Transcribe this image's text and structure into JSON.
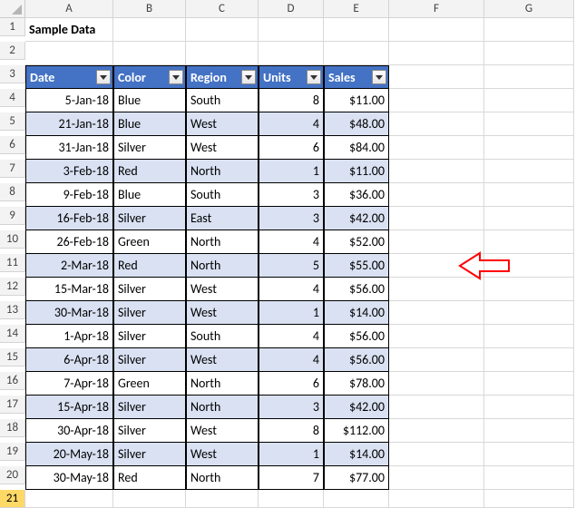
{
  "columns": [
    "A",
    "B",
    "C",
    "D",
    "E",
    "F",
    "G"
  ],
  "row_numbers": [
    1,
    2,
    3,
    4,
    5,
    6,
    7,
    8,
    9,
    10,
    11,
    12,
    13,
    14,
    15,
    16,
    17,
    18,
    19,
    20,
    21
  ],
  "title": "Sample Data",
  "headers": {
    "date": "Date",
    "color": "Color",
    "region": "Region",
    "units": "Units",
    "sales": "Sales"
  },
  "rows": [
    {
      "date": "5-Jan-18",
      "color": "Blue",
      "region": "South",
      "units": "8",
      "sales": "$11.00",
      "band": false
    },
    {
      "date": "21-Jan-18",
      "color": "Blue",
      "region": "West",
      "units": "4",
      "sales": "$48.00",
      "band": true
    },
    {
      "date": "31-Jan-18",
      "color": "Silver",
      "region": "West",
      "units": "6",
      "sales": "$84.00",
      "band": false
    },
    {
      "date": "3-Feb-18",
      "color": "Red",
      "region": "North",
      "units": "1",
      "sales": "$11.00",
      "band": true
    },
    {
      "date": "9-Feb-18",
      "color": "Blue",
      "region": "South",
      "units": "3",
      "sales": "$36.00",
      "band": false
    },
    {
      "date": "16-Feb-18",
      "color": "Silver",
      "region": "East",
      "units": "3",
      "sales": "$42.00",
      "band": true
    },
    {
      "date": "26-Feb-18",
      "color": "Green",
      "region": "North",
      "units": "4",
      "sales": "$52.00",
      "band": false
    },
    {
      "date": "2-Mar-18",
      "color": "Red",
      "region": "North",
      "units": "5",
      "sales": "$55.00",
      "band": true
    },
    {
      "date": "15-Mar-18",
      "color": "Silver",
      "region": "West",
      "units": "4",
      "sales": "$56.00",
      "band": false
    },
    {
      "date": "30-Mar-18",
      "color": "Silver",
      "region": "West",
      "units": "1",
      "sales": "$14.00",
      "band": true
    },
    {
      "date": "1-Apr-18",
      "color": "Silver",
      "region": "South",
      "units": "4",
      "sales": "$56.00",
      "band": false
    },
    {
      "date": "6-Apr-18",
      "color": "Silver",
      "region": "West",
      "units": "4",
      "sales": "$56.00",
      "band": true
    },
    {
      "date": "7-Apr-18",
      "color": "Green",
      "region": "North",
      "units": "6",
      "sales": "$78.00",
      "band": false
    },
    {
      "date": "15-Apr-18",
      "color": "Silver",
      "region": "North",
      "units": "3",
      "sales": "$42.00",
      "band": true
    },
    {
      "date": "30-Apr-18",
      "color": "Silver",
      "region": "West",
      "units": "8",
      "sales": "$112.00",
      "band": false
    },
    {
      "date": "20-May-18",
      "color": "Silver",
      "region": "West",
      "units": "1",
      "sales": "$14.00",
      "band": true
    },
    {
      "date": "30-May-18",
      "color": "Red",
      "region": "North",
      "units": "7",
      "sales": "$77.00",
      "band": false
    }
  ],
  "chart_data": {
    "type": "table",
    "title": "Sample Data",
    "columns": [
      "Date",
      "Color",
      "Region",
      "Units",
      "Sales"
    ],
    "rows": [
      [
        "5-Jan-18",
        "Blue",
        "South",
        8,
        11.0
      ],
      [
        "21-Jan-18",
        "Blue",
        "West",
        4,
        48.0
      ],
      [
        "31-Jan-18",
        "Silver",
        "West",
        6,
        84.0
      ],
      [
        "3-Feb-18",
        "Red",
        "North",
        1,
        11.0
      ],
      [
        "9-Feb-18",
        "Blue",
        "South",
        3,
        36.0
      ],
      [
        "16-Feb-18",
        "Silver",
        "East",
        3,
        42.0
      ],
      [
        "26-Feb-18",
        "Green",
        "North",
        4,
        52.0
      ],
      [
        "2-Mar-18",
        "Red",
        "North",
        5,
        55.0
      ],
      [
        "15-Mar-18",
        "Silver",
        "West",
        4,
        56.0
      ],
      [
        "30-Mar-18",
        "Silver",
        "West",
        1,
        14.0
      ],
      [
        "1-Apr-18",
        "Silver",
        "South",
        4,
        56.0
      ],
      [
        "6-Apr-18",
        "Silver",
        "West",
        4,
        56.0
      ],
      [
        "7-Apr-18",
        "Green",
        "North",
        6,
        78.0
      ],
      [
        "15-Apr-18",
        "Silver",
        "North",
        3,
        42.0
      ],
      [
        "30-Apr-18",
        "Silver",
        "West",
        8,
        112.0
      ],
      [
        "20-May-18",
        "Silver",
        "West",
        1,
        14.0
      ],
      [
        "30-May-18",
        "Red",
        "North",
        7,
        77.0
      ]
    ]
  }
}
